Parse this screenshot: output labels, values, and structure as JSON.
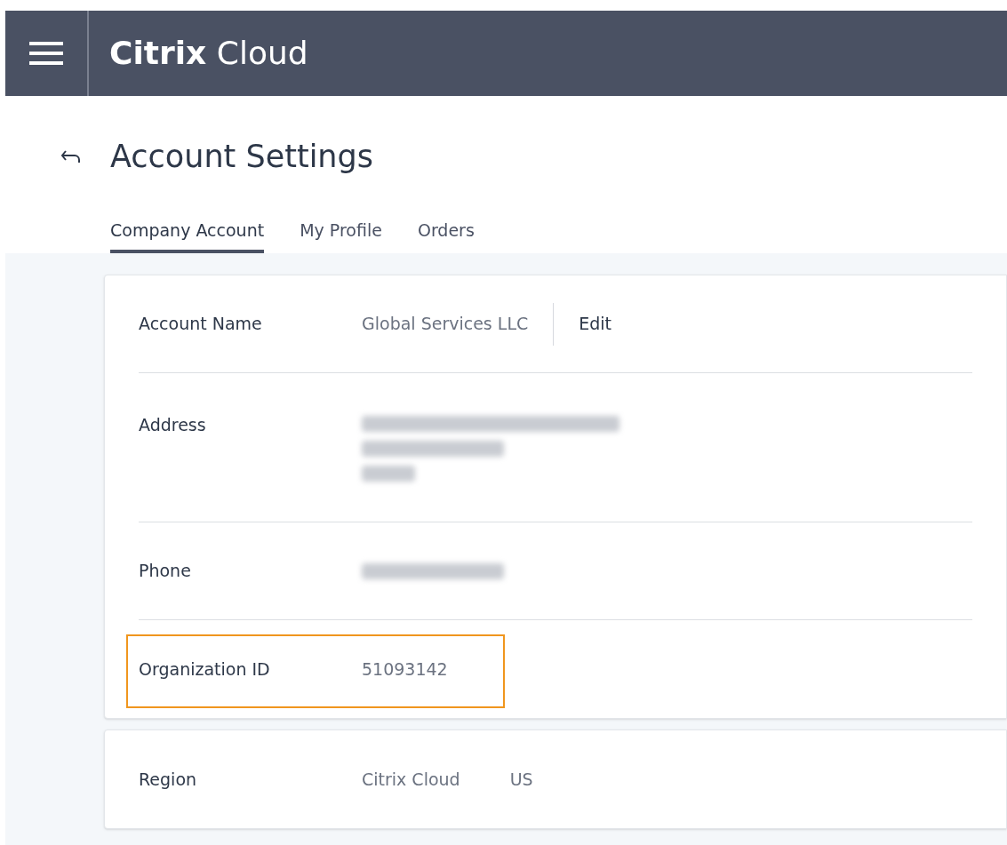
{
  "header": {
    "brand_bold": "Citrix",
    "brand_light": "Cloud"
  },
  "page": {
    "title": "Account Settings"
  },
  "tabs": [
    {
      "label": "Company Account",
      "selected": true
    },
    {
      "label": "My Profile",
      "selected": false
    },
    {
      "label": "Orders",
      "selected": false
    }
  ],
  "cards": [
    {
      "rows": [
        {
          "kind": "text",
          "label": "Account Name",
          "value": "Global Services LLC",
          "action": "Edit",
          "highlighted": false
        },
        {
          "kind": "redacted_block",
          "label": "Address",
          "highlighted": false
        },
        {
          "kind": "redacted_line",
          "label": "Phone",
          "highlighted": false
        },
        {
          "kind": "text",
          "label": "Organization ID",
          "value": "51093142",
          "highlighted": true
        }
      ]
    },
    {
      "rows": [
        {
          "kind": "pair",
          "label": "Region",
          "value": "Citrix Cloud",
          "value_2": "US",
          "highlighted": false
        }
      ]
    }
  ]
}
